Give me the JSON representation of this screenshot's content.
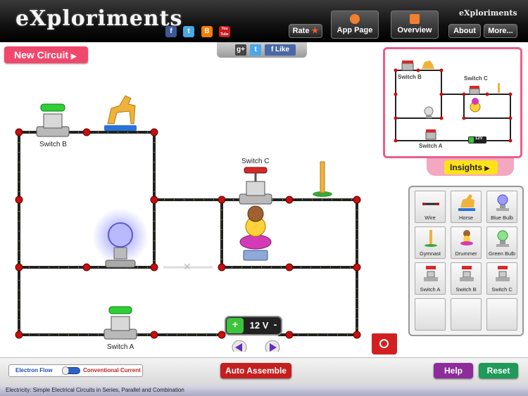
{
  "header": {
    "logo": "eXploriments",
    "brand_small": "eXploriments",
    "rate_label": "Rate",
    "app_page_label": "App Page",
    "overview_label": "Overview",
    "about_label": "About",
    "more_label": "More...",
    "social": [
      {
        "name": "facebook",
        "glyph": "f",
        "color": "#3b5998"
      },
      {
        "name": "twitter",
        "glyph": "t",
        "color": "#4aa8e8"
      },
      {
        "name": "blogger",
        "glyph": "B",
        "color": "#f57d00"
      },
      {
        "name": "youtube",
        "glyph": "You Tube",
        "color": "#cc181e"
      }
    ]
  },
  "toolbar": {
    "new_circuit_label": "New Circuit",
    "share_gplus": "g+",
    "share_twitter": "t",
    "share_like": "Like"
  },
  "circuit": {
    "switch_b_label": "Switch B",
    "switch_c_label": "Switch C",
    "switch_a_label": "Switch A",
    "battery_label": "12 V",
    "battery_plus": "+",
    "battery_minus": "-"
  },
  "preview": {
    "switch_b": "Switch B",
    "switch_c": "Switch C",
    "switch_a": "Switch A",
    "battery": "12V",
    "insights_label": "Insights"
  },
  "palette": {
    "items": [
      {
        "label": "Wire",
        "icon": "wire-icon"
      },
      {
        "label": "Horse",
        "icon": "horse-icon"
      },
      {
        "label": "Blue Bulb",
        "icon": "blue-bulb-icon"
      },
      {
        "label": "Gymnast",
        "icon": "gymnast-icon"
      },
      {
        "label": "Drummer",
        "icon": "drummer-icon"
      },
      {
        "label": "Green Bulb",
        "icon": "green-bulb-icon"
      },
      {
        "label": "Switch A",
        "icon": "switch-icon"
      },
      {
        "label": "Switch B",
        "icon": "switch-icon"
      },
      {
        "label": "Switch C",
        "icon": "switch-icon"
      }
    ]
  },
  "bottom": {
    "electron_flow": "Electron Flow",
    "conventional_current": "Conventional Current",
    "auto_assemble": "Auto Assemble",
    "help": "Help",
    "reset": "Reset"
  },
  "footer": {
    "caption": "Electricity: Simple Electrical Circuits in Series, Parallel and Combination"
  },
  "colors": {
    "pink": "#f0486d",
    "auto_assemble": "#c41e1e",
    "help": "#8e2c9c",
    "reset": "#1f9a58",
    "insights": "#ffe21a"
  }
}
